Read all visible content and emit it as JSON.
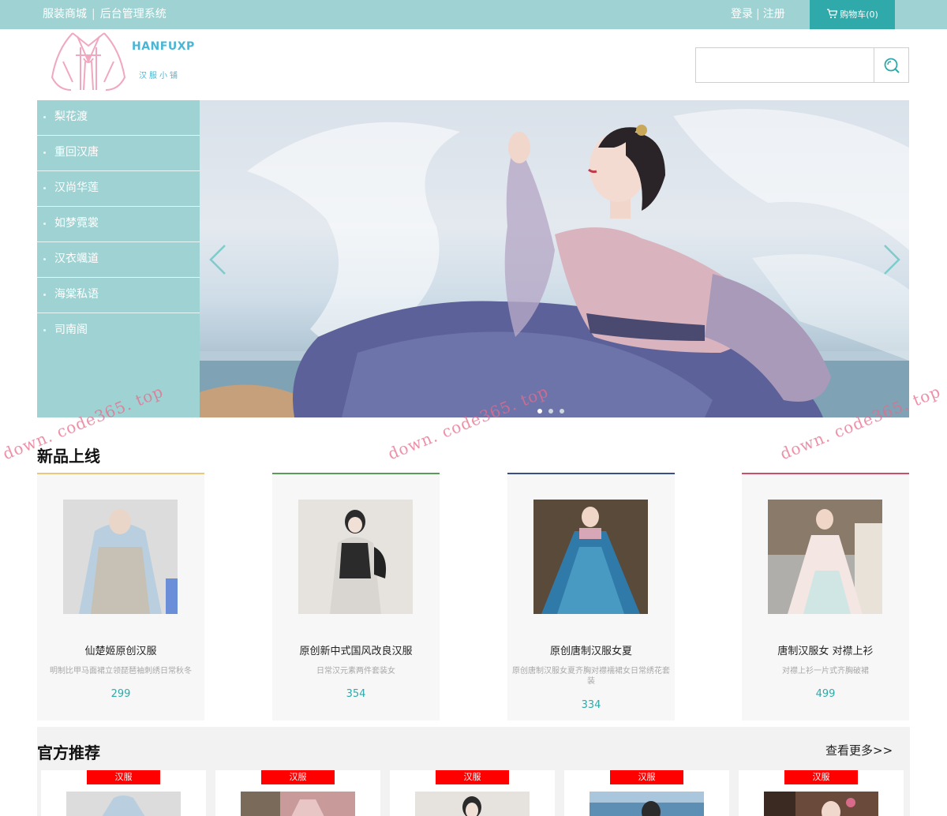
{
  "topbar": {
    "site_name": "服装商城",
    "admin_link": "后台管理系统",
    "login": "登录",
    "register": "注册",
    "cart": "购物车(0)"
  },
  "logo": {
    "name_en": "HANFUXP",
    "name_cn": "汉服小铺"
  },
  "search": {
    "placeholder": "",
    "value": ""
  },
  "categories": [
    "梨花渡",
    "重回汉唐",
    "汉尚华莲",
    "如梦霓裳",
    "汉衣颯道",
    "海棠私语",
    "司南阁"
  ],
  "banner": {
    "slide_count": 3,
    "active_slide": 1
  },
  "watermark": "down. code365. top",
  "new_products": {
    "title": "新品上线",
    "items": [
      {
        "name": "仙楚姬原创汉服",
        "desc": "明制比甲马面裙立领琵琶袖刺绣日常秋冬",
        "price": "299",
        "accent": "#e8c87a"
      },
      {
        "name": "原创新中式国风改良汉服",
        "desc": "日常汉元素两件套装女",
        "price": "354",
        "accent": "#5a9a5a"
      },
      {
        "name": "原创唐制汉服女夏",
        "desc": "原创唐制汉服女夏齐胸对襟襦裙女日常绣花套装",
        "price": "334",
        "accent": "#3a4f8a"
      },
      {
        "name": "唐制汉服女 对襟上衫",
        "desc": "对襟上衫一片式齐胸破裙",
        "price": "499",
        "accent": "#c9506a"
      }
    ]
  },
  "recommended": {
    "title": "官方推荐",
    "more": "查看更多>>",
    "tags": [
      "汉服",
      "汉服",
      "汉服",
      "汉服",
      "汉服"
    ]
  },
  "colors": {
    "topbar": "#9fd3d3",
    "cart": "#2fa9a9",
    "accent_price": "#2fa9a9",
    "tag": "#ff0000"
  }
}
